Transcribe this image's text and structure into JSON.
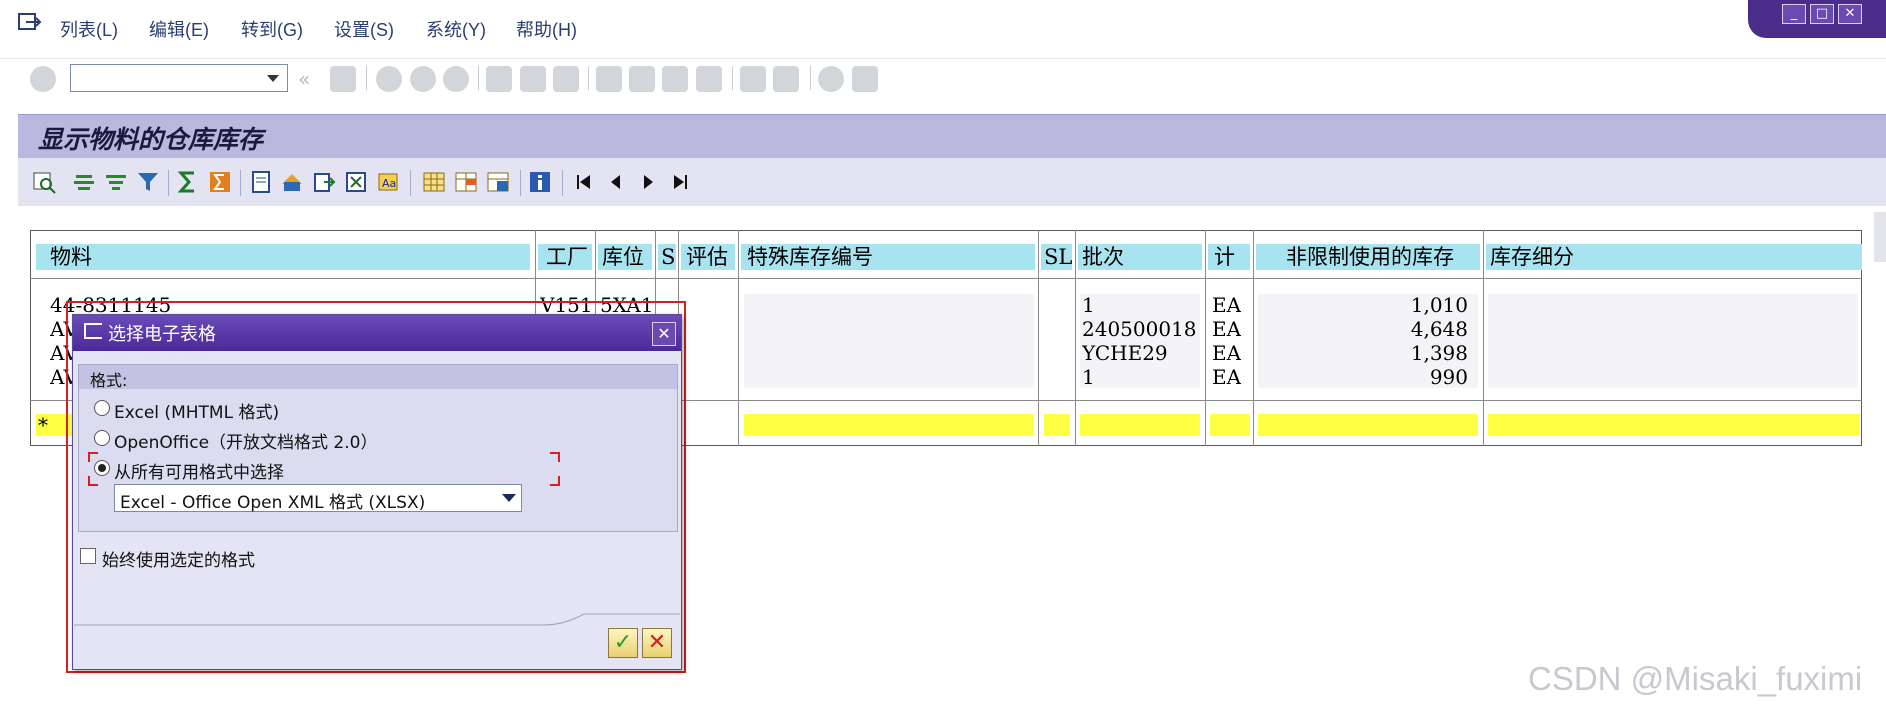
{
  "menu": {
    "items": [
      "列表(L)",
      "编辑(E)",
      "转到(G)",
      "设置(S)",
      "系统(Y)",
      "帮助(H)"
    ]
  },
  "toolbar": {
    "command_field_value": ""
  },
  "window_controls": {
    "minimize": "_",
    "maximize": "□",
    "close": "✕"
  },
  "screen": {
    "title": "显示物料的仓库库存"
  },
  "table": {
    "columns": [
      "物料",
      "工厂",
      "库位",
      "S",
      "评估",
      "特殊库存编号",
      "SL",
      "批次",
      "计",
      "非限制使用的库存",
      "库存细分"
    ],
    "rows": [
      {
        "material": "44-8311145",
        "plant": "V151",
        "sloc": "5XA1",
        "batch": "1",
        "unit": "EA",
        "qty": "1,010"
      },
      {
        "material": "AV",
        "plant": "",
        "sloc": "",
        "batch": "240500018",
        "unit": "EA",
        "qty": "4,648"
      },
      {
        "material": "AV",
        "plant": "",
        "sloc": "",
        "batch": "YCHE29",
        "unit": "EA",
        "qty": "1,398"
      },
      {
        "material": "AV",
        "plant": "",
        "sloc": "",
        "batch": "1",
        "unit": "EA",
        "qty": "990"
      }
    ],
    "total_marker": "*"
  },
  "dialog": {
    "title": "选择电子表格",
    "close": "✕",
    "group_label": "格式:",
    "options": [
      {
        "label": "Excel (MHTML 格式)",
        "selected": false
      },
      {
        "label": "OpenOffice（开放文档格式 2.0）",
        "selected": false
      },
      {
        "label": "从所有可用格式中选择",
        "selected": true
      }
    ],
    "format_select_value": "Excel - Office Open XML 格式 (XLSX)",
    "checkbox_label": "始终使用选定的格式",
    "checkbox_checked": false,
    "ok": "✓",
    "cancel": "✕"
  },
  "watermark": "CSDN @Misaki_fuximi"
}
